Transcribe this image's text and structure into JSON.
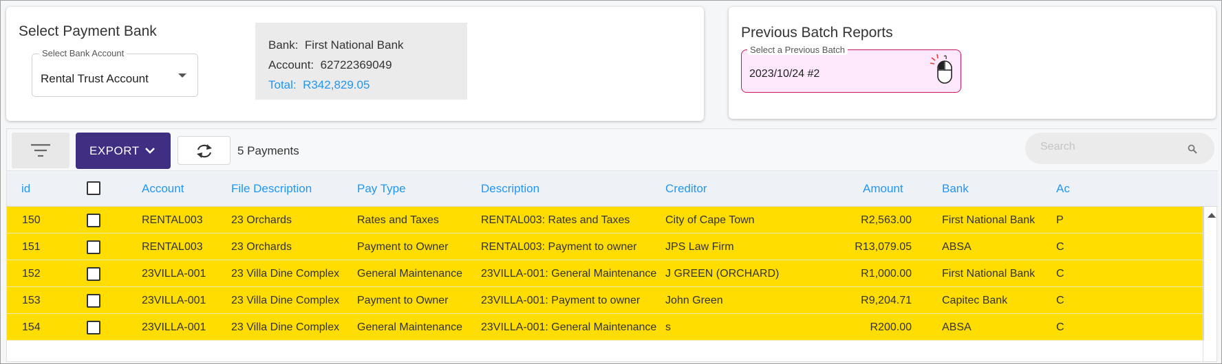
{
  "payment_bank": {
    "title": "Select Payment Bank",
    "select_label": "Select Bank Account",
    "selected": "Rental Trust Account",
    "bank_line": "Bank:  First National Bank",
    "account_line": "Account:  62722369049",
    "total_line": "Total:  R342,829.05"
  },
  "batch_reports": {
    "title": "Previous Batch Reports",
    "select_label": "Select a Previous Batch",
    "selected": "2023/10/24 #2"
  },
  "toolbar": {
    "export_label": "EXPORT",
    "payments_count": "5 Payments",
    "search_placeholder": "Search"
  },
  "table": {
    "headers": {
      "id": "id",
      "account": "Account",
      "file_description": "File Description",
      "pay_type": "Pay Type",
      "description": "Description",
      "creditor": "Creditor",
      "amount": "Amount",
      "bank": "Bank",
      "ac": "Ac"
    },
    "rows": [
      {
        "id": "150",
        "account": "RENTAL003",
        "file_description": "23 Orchards",
        "pay_type": "Rates and Taxes",
        "description": "RENTAL003: Rates and Taxes",
        "creditor": "City of Cape Town",
        "amount": "R2,563.00",
        "bank": "First National Bank",
        "ac": "P"
      },
      {
        "id": "151",
        "account": "RENTAL003",
        "file_description": "23 Orchards",
        "pay_type": "Payment to Owner",
        "description": "RENTAL003: Payment to owner",
        "creditor": "JPS Law Firm",
        "amount": "R13,079.05",
        "bank": "ABSA",
        "ac": "C"
      },
      {
        "id": "152",
        "account": "23VILLA-001",
        "file_description": "23 Villa Dine Complex",
        "pay_type": "General Maintenance",
        "description": "23VILLA-001: General Maintenance",
        "creditor": "J GREEN (ORCHARD)",
        "amount": "R1,000.00",
        "bank": "First National Bank",
        "ac": "C"
      },
      {
        "id": "153",
        "account": "23VILLA-001",
        "file_description": "23 Villa Dine Complex",
        "pay_type": "Payment to Owner",
        "description": "23VILLA-001: Payment to owner",
        "creditor": "John Green",
        "amount": "R9,204.71",
        "bank": "Capitec Bank",
        "ac": "C"
      },
      {
        "id": "154",
        "account": "23VILLA-001",
        "file_description": "23 Villa Dine Complex",
        "pay_type": "General Maintenance",
        "description": "23VILLA-001: General Maintenance",
        "creditor": "s",
        "amount": "R200.00",
        "bank": "ABSA",
        "ac": "C"
      }
    ],
    "row_color": "#ffdd00",
    "header_text_color": "#2196f3"
  },
  "colors": {
    "export_button": "#3f2e82",
    "batch_select_bg": "#fde8fb",
    "batch_select_border": "#c2185b",
    "total_text": "#2196f3"
  }
}
